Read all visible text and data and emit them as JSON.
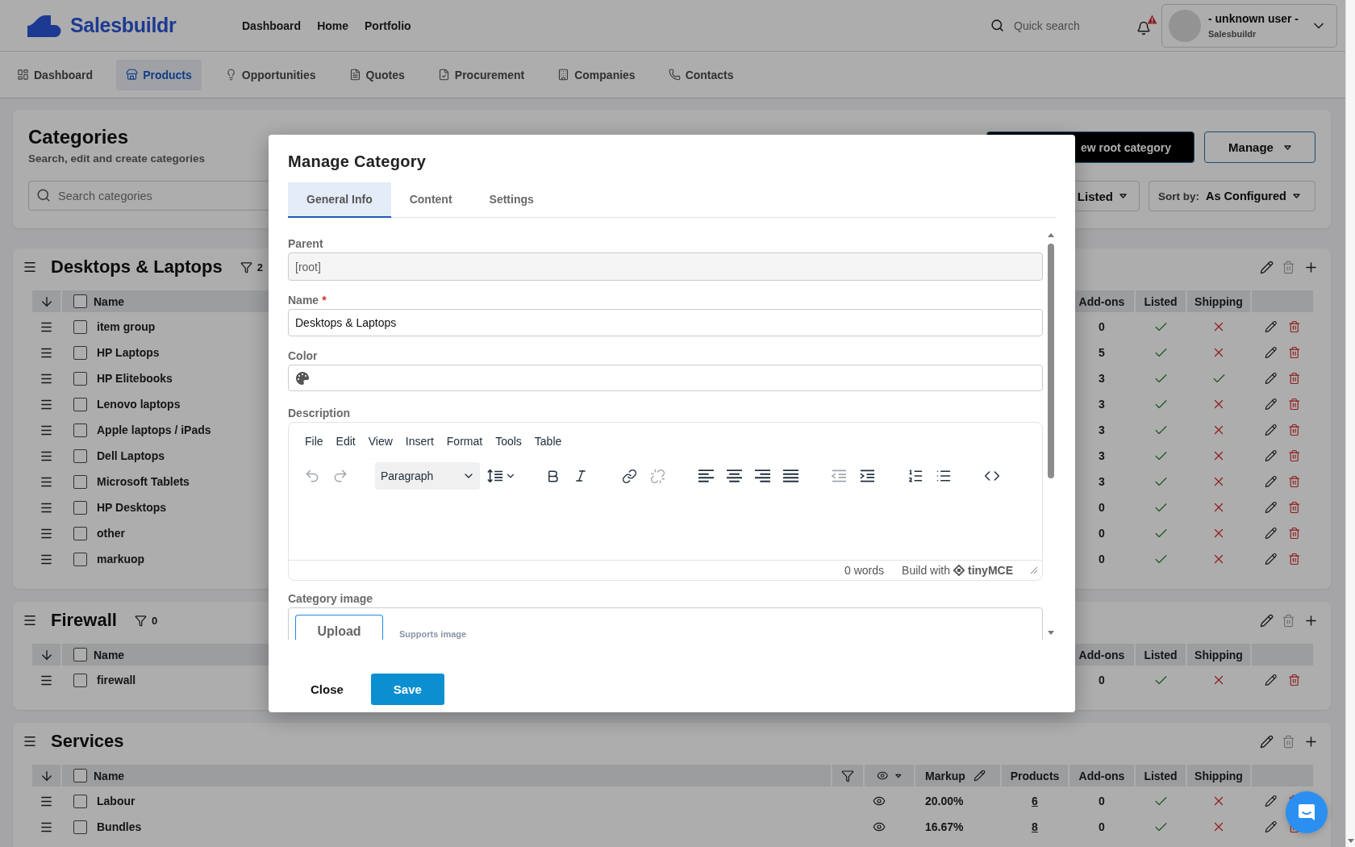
{
  "header": {
    "brand": "Salesbuildr",
    "nav": [
      "Dashboard",
      "Home",
      "Portfolio"
    ],
    "search": {
      "placeholder": "Quick search"
    },
    "notifications": {
      "alert": true
    },
    "user": {
      "name": "- unknown user -",
      "company": "Salesbuildr"
    }
  },
  "tabs": [
    {
      "kind": "dashboard",
      "label": "Dashboard",
      "selected": false
    },
    {
      "kind": "products",
      "label": "Products",
      "selected": true
    },
    {
      "kind": "opportunities",
      "label": "Opportunities",
      "selected": false
    },
    {
      "kind": "quotes",
      "label": "Quotes",
      "selected": false
    },
    {
      "kind": "procurement",
      "label": "Procurement",
      "selected": false
    },
    {
      "kind": "companies",
      "label": "Companies",
      "selected": false
    },
    {
      "kind": "contacts",
      "label": "Contacts",
      "selected": false
    }
  ],
  "categories_panel": {
    "title": "Categories",
    "subtitle": "Search, edit and create categories",
    "search": {
      "placeholder": "Search categories"
    },
    "actions": [
      {
        "kind": "primary",
        "label": "ew root category"
      },
      {
        "kind": "menu",
        "label": "Manage"
      }
    ],
    "filter": {
      "value": "Listed"
    },
    "sort": {
      "label": "Sort by:",
      "value": "As Configured"
    }
  },
  "category_groups": [
    {
      "title": "Desktops & Laptops",
      "filter_count": "2",
      "delete_disabled": true,
      "select_all_checked": false,
      "columns": [
        {
          "kind": "name",
          "label": "Name"
        },
        {
          "kind": "addons",
          "label": "Add-ons"
        },
        {
          "kind": "listed",
          "label": "Listed"
        },
        {
          "kind": "shipping",
          "label": "Shipping"
        }
      ],
      "rows": [
        {
          "name": "item group",
          "checked": false,
          "addons": "0",
          "listed": true,
          "shipping": false
        },
        {
          "name": "HP Laptops",
          "checked": false,
          "addons": "5",
          "listed": true,
          "shipping": false
        },
        {
          "name": "HP Elitebooks",
          "checked": false,
          "addons": "3",
          "listed": true,
          "shipping": true
        },
        {
          "name": "Lenovo laptops",
          "checked": false,
          "addons": "3",
          "listed": true,
          "shipping": false
        },
        {
          "name": "Apple laptops / iPads",
          "checked": false,
          "addons": "3",
          "listed": true,
          "shipping": false
        },
        {
          "name": "Dell Laptops",
          "checked": false,
          "addons": "3",
          "listed": true,
          "shipping": false
        },
        {
          "name": "Microsoft Tablets",
          "checked": false,
          "addons": "3",
          "listed": true,
          "shipping": false
        },
        {
          "name": "HP Desktops",
          "checked": false,
          "addons": "0",
          "listed": true,
          "shipping": false
        },
        {
          "name": "other",
          "checked": false,
          "addons": "0",
          "listed": true,
          "shipping": false
        },
        {
          "name": "markuop",
          "checked": false,
          "addons": "0",
          "listed": true,
          "shipping": false
        }
      ]
    },
    {
      "title": "Firewall",
      "filter_count": "0",
      "delete_disabled": true,
      "select_all_checked": false,
      "columns": [
        {
          "kind": "name",
          "label": "Name"
        },
        {
          "kind": "addons",
          "label": "Add-ons"
        },
        {
          "kind": "listed",
          "label": "Listed"
        },
        {
          "kind": "shipping",
          "label": "Shipping"
        }
      ],
      "rows": [
        {
          "name": "firewall",
          "checked": false,
          "addons": "0",
          "listed": true,
          "shipping": false
        }
      ]
    },
    {
      "title": "Services",
      "delete_disabled": true,
      "select_all_checked": false,
      "columns": [
        {
          "kind": "name",
          "label": "Name"
        },
        {
          "kind": "filter"
        },
        {
          "kind": "visibility"
        },
        {
          "kind": "markup",
          "label": "Markup"
        },
        {
          "kind": "products",
          "label": "Products"
        },
        {
          "kind": "addons",
          "label": "Add-ons"
        },
        {
          "kind": "listed",
          "label": "Listed"
        },
        {
          "kind": "shipping",
          "label": "Shipping"
        }
      ],
      "rows": [
        {
          "name": "Labour",
          "checked": false,
          "markup": "20.00%",
          "products": "6",
          "addons": "0",
          "listed": true,
          "shipping": false
        },
        {
          "name": "Bundles",
          "checked": false,
          "markup": "16.67%",
          "products": "8",
          "addons": "0",
          "listed": true,
          "shipping": false
        }
      ]
    }
  ],
  "modal": {
    "title": "Manage Category",
    "tabs": [
      {
        "label": "General Info",
        "selected": true
      },
      {
        "label": "Content",
        "selected": false
      },
      {
        "label": "Settings",
        "selected": false
      }
    ],
    "fields": [
      {
        "kind": "readonly",
        "label": "Parent",
        "value": "[root]"
      },
      {
        "kind": "text",
        "label": "Name",
        "required_mark": "*",
        "value": "Desktops & Laptops"
      },
      {
        "kind": "color",
        "label": "Color"
      },
      {
        "kind": "editor",
        "label": "Description",
        "menu": [
          "File",
          "Edit",
          "View",
          "Insert",
          "Format",
          "Tools",
          "Table"
        ],
        "toolbar_groups": [
          {
            "items": [
              {
                "kind": "undo",
                "disabled": true
              },
              {
                "kind": "redo",
                "disabled": true
              }
            ]
          },
          {
            "items": [
              {
                "kind": "block_format",
                "value": "Paragraph",
                "disabled": false
              },
              {
                "kind": "line_height",
                "disabled": false
              }
            ]
          },
          {
            "items": [
              {
                "kind": "bold",
                "disabled": false
              },
              {
                "kind": "italic",
                "disabled": false
              }
            ]
          },
          {
            "items": [
              {
                "kind": "link",
                "disabled": false
              },
              {
                "kind": "unlink",
                "disabled": true
              }
            ]
          },
          {
            "items": [
              {
                "kind": "align_left",
                "disabled": false
              },
              {
                "kind": "align_center",
                "disabled": false
              },
              {
                "kind": "align_right",
                "disabled": false
              },
              {
                "kind": "align_justify",
                "disabled": false
              }
            ]
          },
          {
            "items": [
              {
                "kind": "outdent",
                "disabled": true
              },
              {
                "kind": "indent",
                "disabled": false
              }
            ]
          },
          {
            "items": [
              {
                "kind": "numbered_list",
                "disabled": false
              },
              {
                "kind": "bullet_list",
                "disabled": false
              }
            ]
          },
          {
            "items": [
              {
                "kind": "code",
                "disabled": false
              }
            ]
          }
        ],
        "word_count": "0 words",
        "branding": {
          "prefix": "Build with",
          "brand": "tinyMCE"
        }
      },
      {
        "kind": "image",
        "label": "Category image",
        "upload_tabs": [
          {
            "label": "Upload",
            "selected": true
          }
        ],
        "note": "Supports image"
      }
    ],
    "buttons": [
      {
        "kind": "secondary",
        "label": "Close"
      },
      {
        "kind": "primary",
        "label": "Save"
      }
    ]
  }
}
